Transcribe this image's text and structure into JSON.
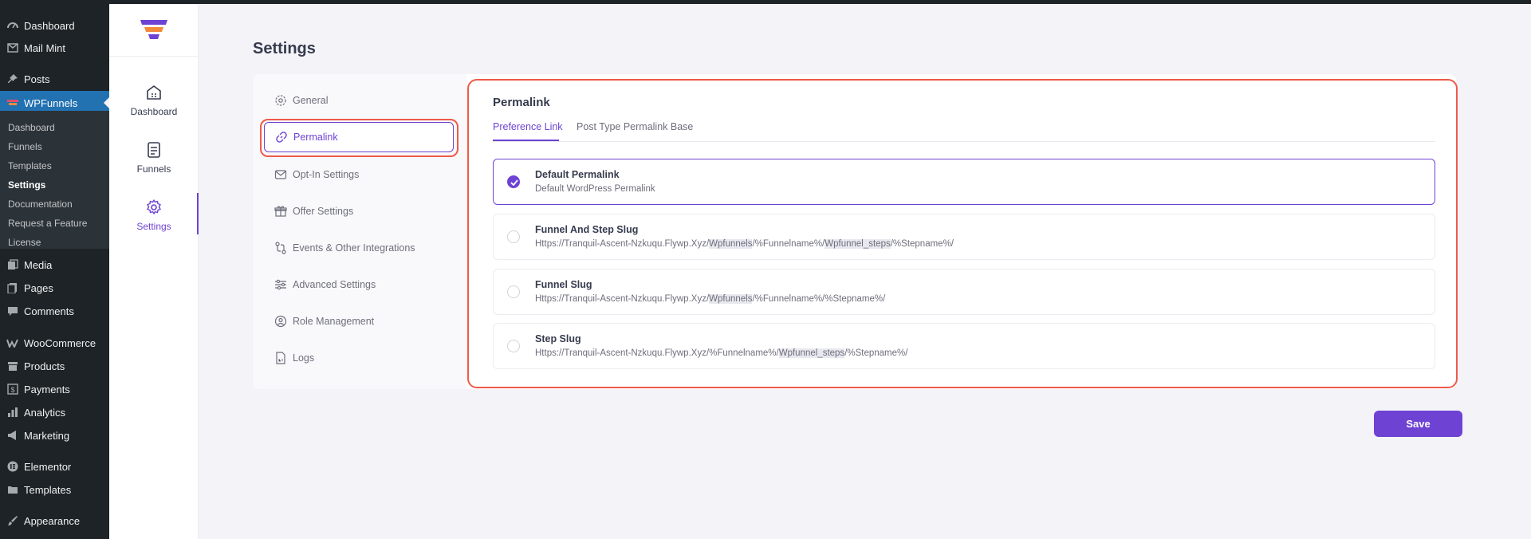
{
  "wp_menu": {
    "dashboard": "Dashboard",
    "mail_mint": "Mail Mint",
    "posts": "Posts",
    "wpfunnels": "WPFunnels",
    "sub": [
      "Dashboard",
      "Funnels",
      "Templates",
      "Settings",
      "Documentation",
      "Request a Feature",
      "License"
    ],
    "media": "Media",
    "pages": "Pages",
    "comments": "Comments",
    "woocommerce": "WooCommerce",
    "products": "Products",
    "payments": "Payments",
    "analytics": "Analytics",
    "marketing": "Marketing",
    "elementor": "Elementor",
    "templates": "Templates",
    "appearance": "Appearance"
  },
  "rail": {
    "dashboard": "Dashboard",
    "funnels": "Funnels",
    "settings": "Settings"
  },
  "page_title": "Settings",
  "settings_menu": {
    "general": "General",
    "permalink": "Permalink",
    "optin": "Opt-In Settings",
    "offer": "Offer Settings",
    "events": "Events & Other Integrations",
    "advanced": "Advanced Settings",
    "role": "Role Management",
    "logs": "Logs"
  },
  "panel": {
    "title": "Permalink",
    "tabs": [
      "Preference Link",
      "Post Type Permalink Base"
    ],
    "options": [
      {
        "title": "Default Permalink",
        "desc": "Default WordPress Permalink",
        "selected": true
      },
      {
        "title": "Funnel And Step Slug",
        "desc_parts": [
          "Https://Tranquil-Ascent-Nzkuqu.Flywp.Xyz/",
          "Wpfunnels",
          "/%Funnelname%/",
          "Wpfunnel_steps",
          "/%Stepname%/"
        ]
      },
      {
        "title": "Funnel Slug",
        "desc_parts": [
          "Https://Tranquil-Ascent-Nzkuqu.Flywp.Xyz/",
          "Wpfunnels",
          "/%Funnelname%/%Stepname%/"
        ]
      },
      {
        "title": "Step Slug",
        "desc_parts": [
          "Https://Tranquil-Ascent-Nzkuqu.Flywp.Xyz/%Funnelname%/",
          "Wpfunnel_steps",
          "/%Stepname%/"
        ]
      }
    ]
  },
  "save_label": "Save",
  "colors": {
    "accent": "#6e42d3",
    "highlight": "#ef5a4a",
    "wp_active": "#2271b1"
  }
}
